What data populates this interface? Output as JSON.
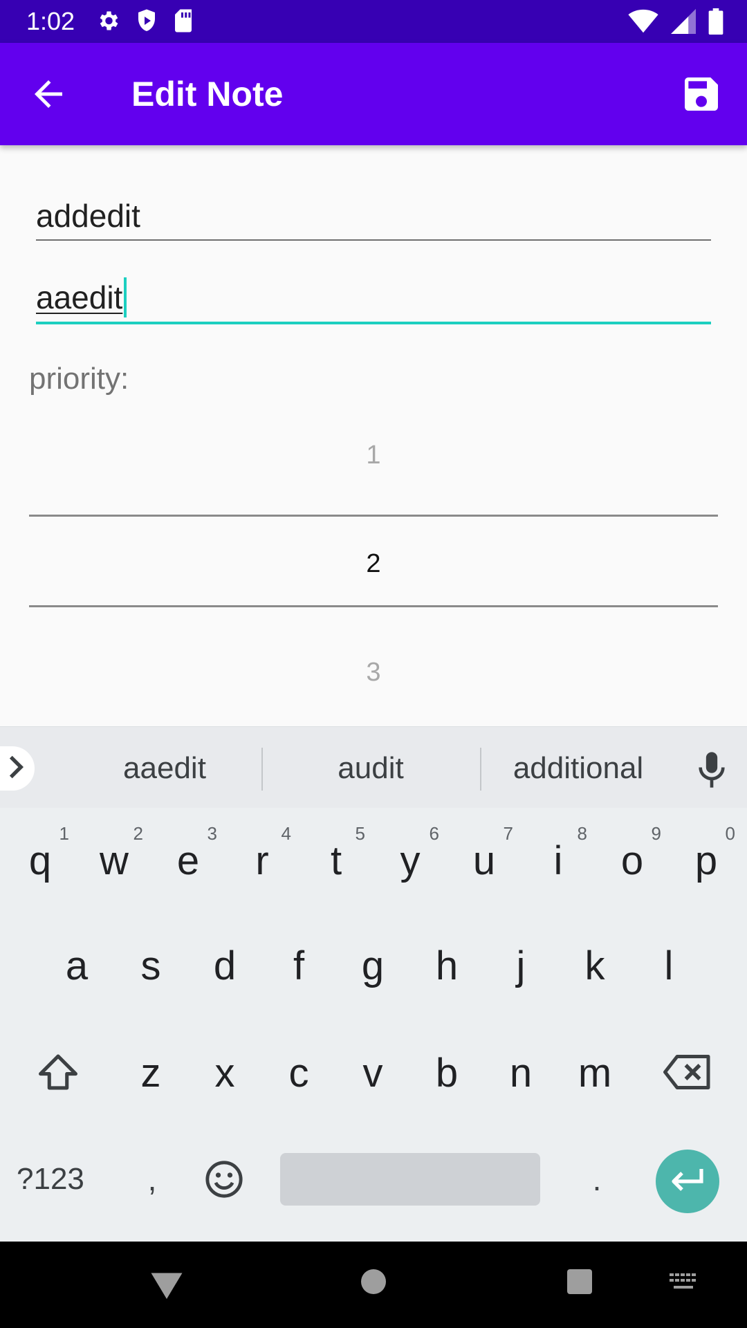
{
  "status_bar": {
    "time": "1:02",
    "left_icons": [
      "gear-icon",
      "shield-icon",
      "sd-card-icon"
    ],
    "right_icons": [
      "wifi-icon",
      "signal-icon",
      "battery-icon"
    ]
  },
  "app_bar": {
    "title": "Edit Note",
    "back_icon": "arrow-back-icon",
    "save_icon": "save-icon"
  },
  "form": {
    "title_value": "addedit",
    "description_value": "aaedit",
    "priority_label": "priority:",
    "priority_options": [
      "1",
      "2",
      "3"
    ],
    "priority_selected": "2"
  },
  "keyboard": {
    "suggestions": [
      "aaedit",
      "audit",
      "additional"
    ],
    "row1": [
      {
        "key": "q",
        "hint": "1"
      },
      {
        "key": "w",
        "hint": "2"
      },
      {
        "key": "e",
        "hint": "3"
      },
      {
        "key": "r",
        "hint": "4"
      },
      {
        "key": "t",
        "hint": "5"
      },
      {
        "key": "y",
        "hint": "6"
      },
      {
        "key": "u",
        "hint": "7"
      },
      {
        "key": "i",
        "hint": "8"
      },
      {
        "key": "o",
        "hint": "9"
      },
      {
        "key": "p",
        "hint": "0"
      }
    ],
    "row2": [
      "a",
      "s",
      "d",
      "f",
      "g",
      "h",
      "j",
      "k",
      "l"
    ],
    "row3": [
      "z",
      "x",
      "c",
      "v",
      "b",
      "n",
      "m"
    ],
    "symbols_label": "?123",
    "comma": ",",
    "period": "."
  },
  "colors": {
    "status_bar": "#3700b3",
    "app_bar": "#6200ee",
    "accent": "#1ccfc0",
    "enter_key": "#4db6ac"
  }
}
